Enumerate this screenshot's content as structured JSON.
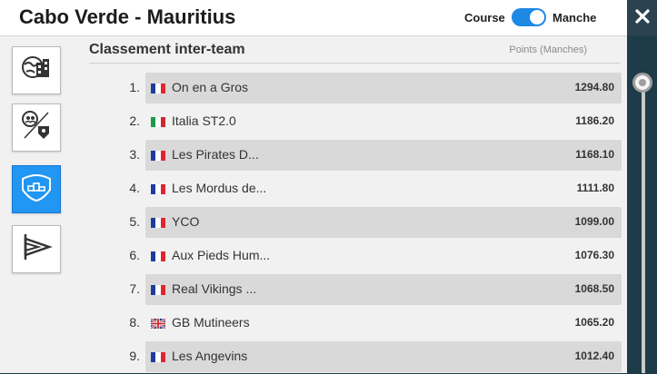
{
  "header": {
    "title": "Cabo Verde - Mauritius",
    "toggle_left_label": "Course",
    "toggle_right_label": "Manche",
    "toggle_state": "on",
    "accent_color": "#1e88e5"
  },
  "sidebar": {
    "items": [
      {
        "icon": "globe-buildings-icon",
        "active": false
      },
      {
        "icon": "team-vs-icon",
        "active": false
      },
      {
        "icon": "team-ranking-icon",
        "active": true
      },
      {
        "icon": "race-flag-icon",
        "active": false
      }
    ]
  },
  "ranking": {
    "title": "Classement inter-team",
    "subtitle": "Points (Manches)",
    "rows": [
      {
        "rank": "1.",
        "flag": "fr",
        "name": "On en a Gros",
        "points": "1294.80"
      },
      {
        "rank": "2.",
        "flag": "it",
        "name": "Italia ST2.0",
        "points": "1186.20"
      },
      {
        "rank": "3.",
        "flag": "fr",
        "name": "Les Pirates D...",
        "points": "1168.10"
      },
      {
        "rank": "4.",
        "flag": "fr",
        "name": "Les Mordus de...",
        "points": "1111.80"
      },
      {
        "rank": "5.",
        "flag": "fr",
        "name": "YCO",
        "points": "1099.00"
      },
      {
        "rank": "6.",
        "flag": "fr",
        "name": "Aux Pieds Hum...",
        "points": "1076.30"
      },
      {
        "rank": "7.",
        "flag": "fr",
        "name": "Real Vikings ...",
        "points": "1068.50"
      },
      {
        "rank": "8.",
        "flag": "gb",
        "name": "GB Mutineers",
        "points": "1065.20"
      },
      {
        "rank": "9.",
        "flag": "fr",
        "name": "Les Angevins",
        "points": "1012.40"
      }
    ]
  }
}
